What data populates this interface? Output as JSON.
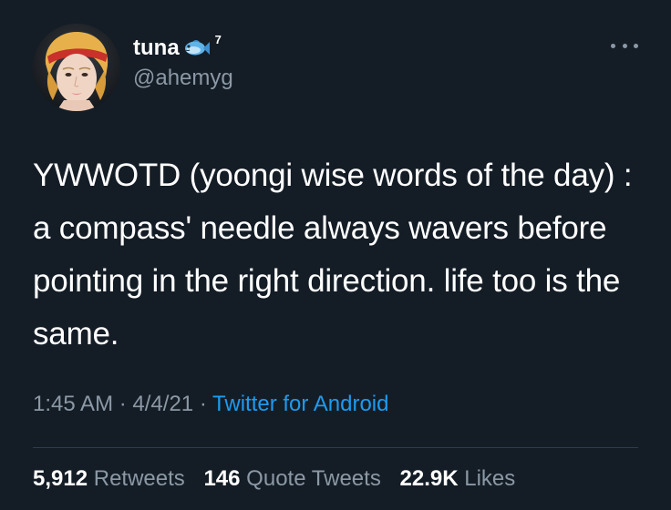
{
  "author": {
    "display_name": "tuna",
    "name_emoji": "fish-icon",
    "name_superscript": "7",
    "handle": "@ahemyg"
  },
  "tweet": {
    "text": "YWWOTD (yoongi wise words of the day) : a compass' needle always wavers before pointing in the right direction. life too is the same.",
    "time": "1:45 AM",
    "separator": "·",
    "date": "4/4/21",
    "source": "Twitter for Android"
  },
  "stats": {
    "retweets_count": "5,912",
    "retweets_label": "Retweets",
    "quotes_count": "146",
    "quotes_label": "Quote Tweets",
    "likes_count": "22.9K",
    "likes_label": "Likes"
  },
  "colors": {
    "background": "#141d26",
    "text_primary": "#ffffff",
    "text_secondary": "#8b98a5",
    "link": "#1d9bf0"
  }
}
